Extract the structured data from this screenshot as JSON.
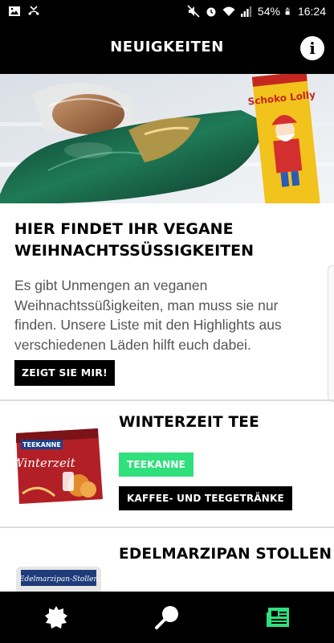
{
  "status_bar": {
    "battery": "54%",
    "time": "16:24",
    "icons": [
      "image-icon",
      "missed-call-icon",
      "mute-icon",
      "alarm-icon",
      "wifi-icon",
      "signal-icon",
      "battery-icon"
    ]
  },
  "app_bar": {
    "title": "NEUIGKEITEN",
    "info_icon": "info-icon"
  },
  "feature": {
    "title": "HIER FINDET IHR VEGANE WEIHNACHTSSÜSSIGKEITEN",
    "body": "Es gibt Unmengen an veganen Weihnachtssüßigkeiten, man muss sie nur finden. Unsere Liste mit den Highlights aus verschiedenen Läden hilft euch dabei.",
    "cta": "ZEIGT SIE MIR!",
    "image_text": {
      "lolly": "Schoko Lolly"
    }
  },
  "products": [
    {
      "name": "WINTERZEIT TEE",
      "brand": "TEEKANNE",
      "category": "KAFFEE- UND TEEGETRÄNKE",
      "pack": {
        "brand": "TEEKANNE",
        "name": "Winterzeit"
      }
    },
    {
      "name": "EDELMARZIPAN STOLLEN",
      "pack": {
        "name": "Edelmarzipan-Stollen"
      }
    }
  ],
  "bottom_nav": {
    "items": [
      {
        "icon": "badge-icon"
      },
      {
        "icon": "search-icon"
      },
      {
        "icon": "news-icon",
        "active": true
      }
    ],
    "active_color": "#2fe07c"
  },
  "colors": {
    "accent": "#2fe07c",
    "bar": "#000000",
    "body_text": "#555555"
  }
}
